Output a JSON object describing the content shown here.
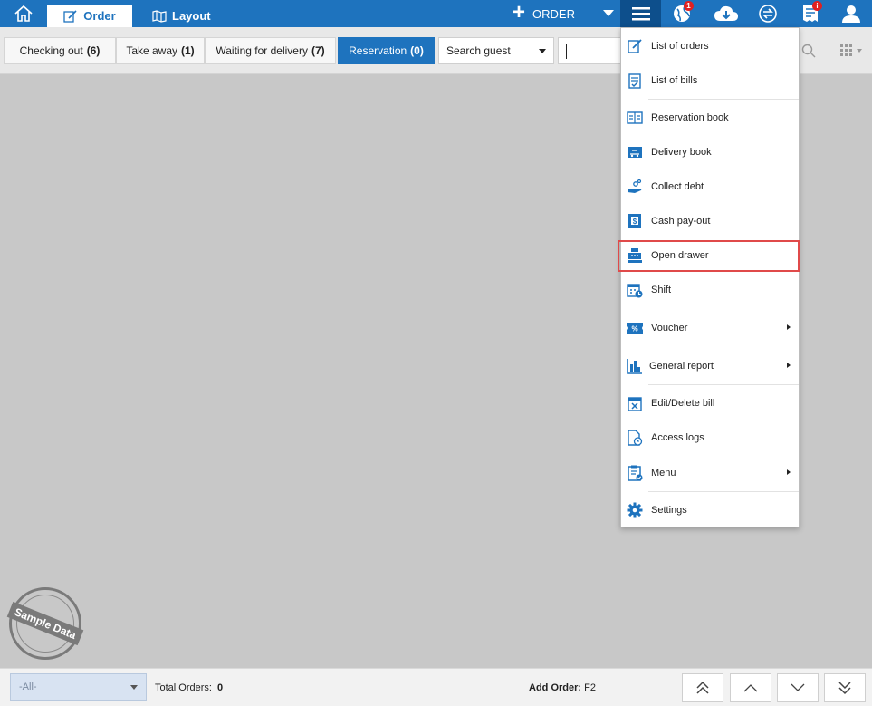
{
  "topbar": {
    "tabs": [
      {
        "label": "Order",
        "active": true
      },
      {
        "label": "Layout",
        "active": false
      }
    ],
    "add_order_label": "ORDER",
    "notifications": {
      "globe_badge": "1",
      "receipt_badge": "i"
    }
  },
  "filters": [
    {
      "label": "Checking out",
      "count": "(6)",
      "active": false
    },
    {
      "label": "Take away",
      "count": "(1)",
      "active": false
    },
    {
      "label": "Waiting for delivery",
      "count": "(7)",
      "active": false
    },
    {
      "label": "Reservation",
      "count": "(0)",
      "active": true
    }
  ],
  "search": {
    "guest_select": "Search guest",
    "query": ""
  },
  "menu": {
    "items": [
      {
        "label": "List of orders",
        "icon": "edit-icon",
        "submenu": false
      },
      {
        "label": "List of bills",
        "icon": "bill-icon",
        "submenu": false
      },
      {
        "label": "Reservation book",
        "icon": "book-icon",
        "submenu": false
      },
      {
        "label": "Delivery book",
        "icon": "delivery-icon",
        "submenu": false
      },
      {
        "label": "Collect debt",
        "icon": "coins-hand-icon",
        "submenu": false
      },
      {
        "label": "Cash pay-out",
        "icon": "cash-icon",
        "submenu": false
      },
      {
        "label": "Open drawer",
        "icon": "cash-register-icon",
        "submenu": false,
        "highlighted": true
      },
      {
        "label": "Shift",
        "icon": "calendar-clock-icon",
        "submenu": false
      },
      {
        "label": "Voucher",
        "icon": "voucher-icon",
        "submenu": true
      },
      {
        "label": "General report",
        "icon": "bar-chart-icon",
        "submenu": true
      },
      {
        "label": "Edit/Delete bill",
        "icon": "calendar-x-icon",
        "submenu": false
      },
      {
        "label": "Access logs",
        "icon": "document-clock-icon",
        "submenu": false
      },
      {
        "label": "Menu",
        "icon": "clipboard-check-icon",
        "submenu": true
      },
      {
        "label": "Settings",
        "icon": "gear-icon",
        "submenu": false
      }
    ]
  },
  "stamp": {
    "label": "Sample Data"
  },
  "footer": {
    "filter_select": "-All-",
    "total_orders_label": "Total Orders:",
    "total_orders_value": "0",
    "add_order_hint_label": "Add Order:",
    "add_order_hint_key": "F2"
  },
  "colors": {
    "primary": "#1e73be",
    "menu_active": "#0d4f8c",
    "highlight": "#e04a4a",
    "canvas": "#c8c8c8"
  }
}
